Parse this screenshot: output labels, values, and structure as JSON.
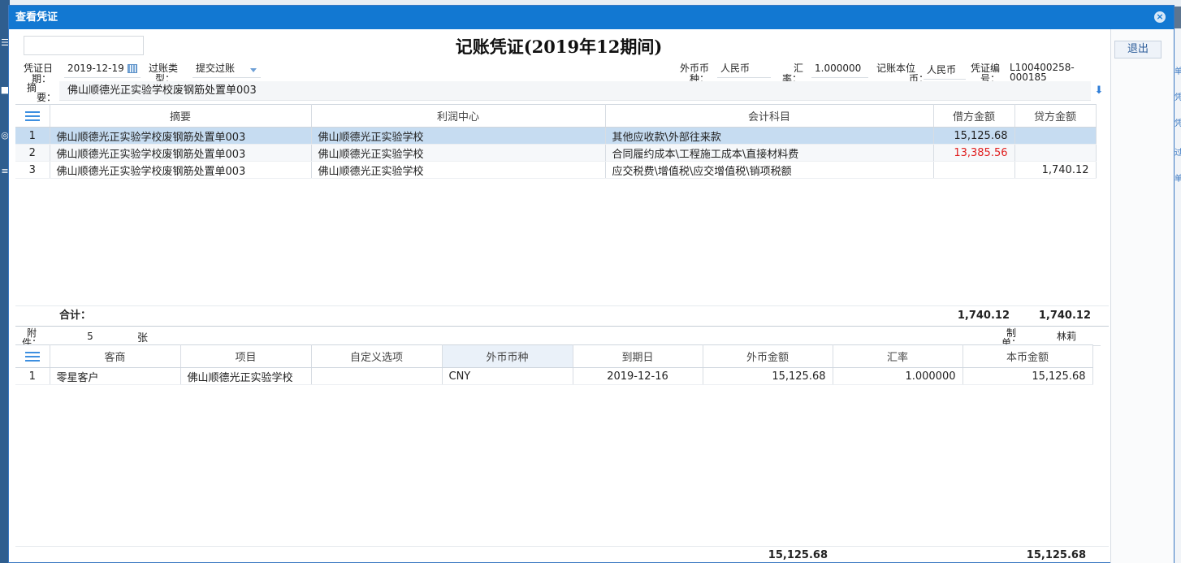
{
  "background": {
    "left_icons": [
      "☰",
      "■",
      "◎",
      "≡"
    ],
    "right_texts": [
      "单",
      "凭",
      "凭",
      "过",
      "单"
    ]
  },
  "dialog": {
    "title": "查看凭证",
    "close_glyph": "×"
  },
  "side": {
    "exit_label": "退出"
  },
  "voucher": {
    "heading": "记账凭证(2019年12期间)",
    "date_label_1": "凭证日",
    "date_label_2": "期：",
    "date_value": "2019-12-19",
    "type_label_1": "过账类",
    "type_label_2": "型：",
    "type_value": "提交过账",
    "fx_label_1": "外币币",
    "fx_label_2": "种：",
    "fx_value": "人民币",
    "rate_label_1": "汇",
    "rate_label_2": "率：",
    "rate_value": "1.000000",
    "base_label_1": "记账本位",
    "base_label_2": "币：",
    "base_value": "人民币",
    "no_label_1": "凭证编",
    "no_label_2": "号：",
    "no_value_1": "L100400258-",
    "no_value_2": "000185",
    "summary_label_1": "摘",
    "summary_label_2": "要：",
    "summary_value": "佛山顺德光正实验学校废钢筋处置单003",
    "down_glyph": "⬇"
  },
  "entries": {
    "headers": [
      "摘要",
      "利润中心",
      "会计科目",
      "借方金额",
      "贷方金额"
    ],
    "rows": [
      {
        "idx": "1",
        "summary": "佛山顺德光正实验学校废钢筋处置单003",
        "center": "佛山顺德光正实验学校",
        "account": "其他应收款\\外部往来款",
        "debit": "15,125.68",
        "credit": ""
      },
      {
        "idx": "2",
        "summary": "佛山顺德光正实验学校废钢筋处置单003",
        "center": "佛山顺德光正实验学校",
        "account": "合同履约成本\\工程施工成本\\直接材料费",
        "debit": "13,385.56",
        "credit": ""
      },
      {
        "idx": "3",
        "summary": "佛山顺德光正实验学校废钢筋处置单003",
        "center": "佛山顺德光正实验学校",
        "account": "应交税费\\增值税\\应交增值税\\销项税额",
        "debit": "",
        "credit": "1,740.12"
      }
    ],
    "negative_color": "#e02020",
    "total_label": "合计：",
    "total_debit": "1,740.12",
    "total_credit": "1,740.12"
  },
  "attach": {
    "label_1": "附",
    "label_2": "件：",
    "count": "5",
    "unit": "张",
    "maker_label_1": "制",
    "maker_label_2": "单：",
    "maker_value": "林莉"
  },
  "details": {
    "headers": [
      "客商",
      "项目",
      "自定义选项",
      "外币币种",
      "到期日",
      "外币金额",
      "汇率",
      "本币金额"
    ],
    "rows": [
      {
        "idx": "1",
        "customer": "零星客户",
        "project": "佛山顺德光正实验学校",
        "custom": "",
        "currency": "CNY",
        "due": "2019-12-16",
        "fx_amount": "15,125.68",
        "rate": "1.000000",
        "local_amount": "15,125.68"
      }
    ],
    "total_fx": "15,125.68",
    "total_local": "15,125.68"
  }
}
